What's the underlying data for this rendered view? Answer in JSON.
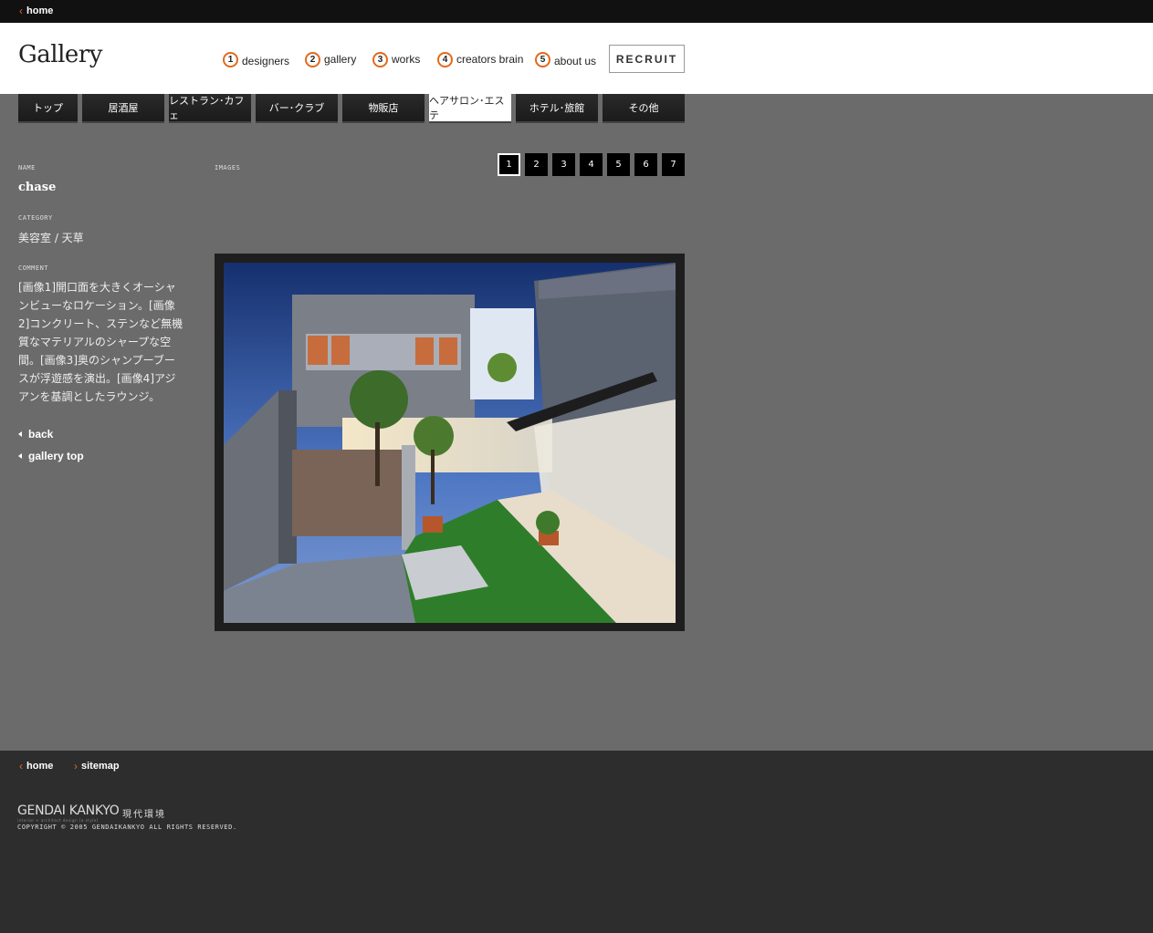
{
  "topbar": {
    "home": "home"
  },
  "header": {
    "title": "Gallery",
    "nav": [
      {
        "num": "1",
        "label": "designers"
      },
      {
        "num": "2",
        "label": "gallery"
      },
      {
        "num": "3",
        "label": "works"
      },
      {
        "num": "4",
        "label": "creators brain"
      },
      {
        "num": "5",
        "label": "about us"
      }
    ],
    "recruit": "RECRUIT"
  },
  "tabs": [
    "トップ",
    "居酒屋",
    "レストラン･カフェ",
    "バー･クラブ",
    "物販店",
    "ヘアサロン･エステ",
    "ホテル･旅館",
    "その他"
  ],
  "active_tab": "ヘアサロン･エステ",
  "info": {
    "name_label": "name",
    "name": "chase",
    "category_label": "category",
    "category": "美容室 / 天草",
    "comment_label": "comment",
    "comment": "[画像1]開口面を大きくオーシャンビューなロケーション。[画像2]コンクリート、ステンなど無機質なマテリアルのシャープな空間。[画像3]奥のシャンプーブースが浮遊感を演出。[画像4]アジアンを基調としたラウンジ。",
    "back": "back",
    "gallery_top": "gallery top"
  },
  "images": {
    "label": "images",
    "pages": [
      "1",
      "2",
      "3",
      "4",
      "5",
      "6",
      "7"
    ],
    "current_page": "1"
  },
  "footer": {
    "home": "home",
    "sitemap": "sitemap",
    "brand": "GENDAI KANKYO",
    "brand_jp": "現代環境",
    "tagline": "interior + architect design [a style]",
    "copyright": "COPYRIGHT © 2005 GENDAIKANKYO ALL RIGHTS RESERVED."
  },
  "colors": {
    "accent": "#e26a1c",
    "background": "#6b6b6b",
    "footer": "#2d2d2d"
  }
}
